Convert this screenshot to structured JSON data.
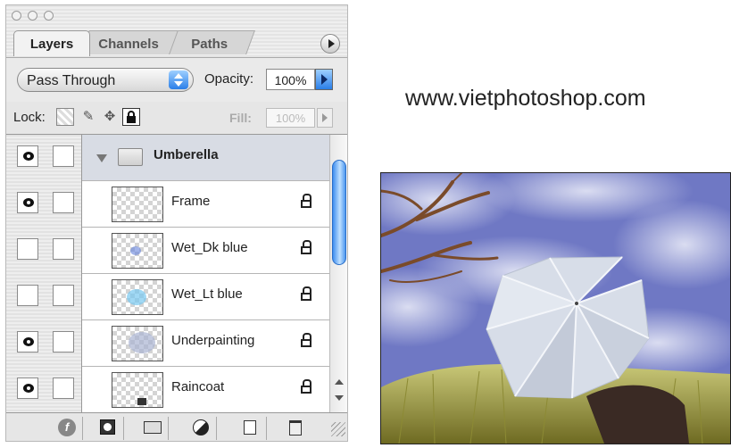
{
  "panel": {
    "tabs": [
      "Layers",
      "Channels",
      "Paths"
    ],
    "blend_mode": "Pass Through",
    "opacity_label": "Opacity:",
    "opacity_value": "100%",
    "lock_label": "Lock:",
    "fill_label": "Fill:",
    "fill_value": "100%"
  },
  "layers": {
    "group": {
      "name": "Umberella",
      "visible": true,
      "expanded": true
    },
    "items": [
      {
        "name": "Frame",
        "visible": true,
        "locked": true
      },
      {
        "name": "Wet_Dk blue",
        "visible": false,
        "locked": true
      },
      {
        "name": "Wet_Lt blue",
        "visible": false,
        "locked": true
      },
      {
        "name": "Underpainting",
        "visible": true,
        "locked": true
      },
      {
        "name": "Raincoat",
        "visible": true,
        "locked": true
      }
    ]
  },
  "website": "www.vietphotoshop.com",
  "colors": {
    "accent": "#2a7ee8",
    "sky": "#6f78c4",
    "grass": "#9a9a3c"
  }
}
